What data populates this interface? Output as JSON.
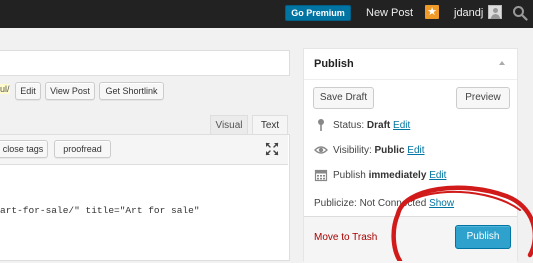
{
  "adminbar": {
    "go_premium": "Go Premium",
    "new_post": "New Post",
    "username": "jdandj"
  },
  "permalink": {
    "tail_text": "ul/",
    "buttons": [
      {
        "label": "Edit"
      },
      {
        "label": "View Post"
      },
      {
        "label": "Get Shortlink"
      }
    ]
  },
  "editor": {
    "tabs": {
      "visual": "Visual",
      "text": "Text"
    },
    "quicktags": [
      {
        "label": "close tags"
      },
      {
        "label": "proofread"
      }
    ],
    "code_line": "art-for-sale/\" title=\"Art for sale\""
  },
  "publish": {
    "title": "Publish",
    "save_draft": "Save Draft",
    "preview": "Preview",
    "status_label": "Status:",
    "status_value": "Draft",
    "status_edit": "Edit",
    "visibility_label": "Visibility:",
    "visibility_value": "Public",
    "visibility_edit": "Edit",
    "schedule_label": "Publish",
    "schedule_value": "immediately",
    "schedule_edit": "Edit",
    "publicize_label": "Publicize: Not Connected",
    "publicize_show": "Show",
    "trash": "Move to Trash",
    "publish_button": "Publish"
  },
  "colors": {
    "adminbar_bg": "#222222",
    "premium_blue": "#0074a2",
    "primary_button": "#2ea2cc",
    "annotation_red": "#d11a1a",
    "trash_red": "#aa0000"
  }
}
